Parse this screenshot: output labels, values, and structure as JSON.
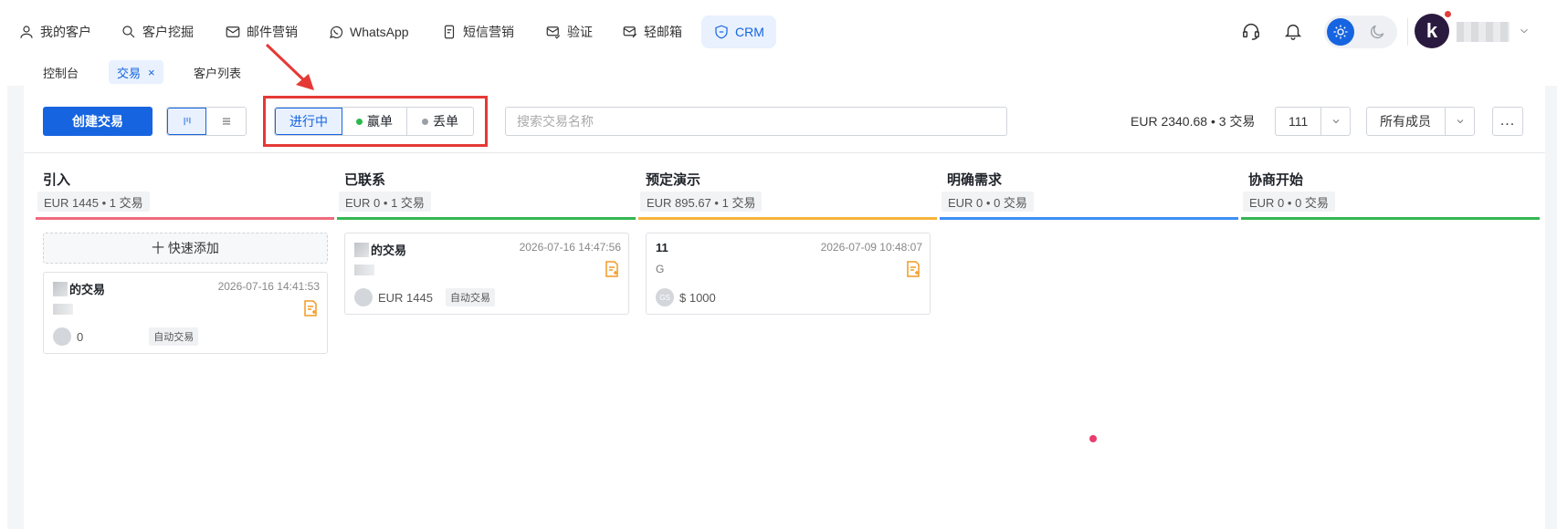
{
  "nav": {
    "items": [
      {
        "label": "我的客户",
        "icon": "user-icon"
      },
      {
        "label": "客户挖掘",
        "icon": "search-icon"
      },
      {
        "label": "邮件营销",
        "icon": "mail-icon"
      },
      {
        "label": "WhatsApp",
        "icon": "whatsapp-icon"
      },
      {
        "label": "短信营销",
        "icon": "sms-icon"
      },
      {
        "label": "验证",
        "icon": "mail-check-icon"
      },
      {
        "label": "轻邮箱",
        "icon": "mail-edit-icon"
      },
      {
        "label": "CRM",
        "icon": "shield-icon"
      }
    ],
    "active": "CRM"
  },
  "header_icons": [
    "headset-icon",
    "bell-icon",
    "sun-icon",
    "moon-icon",
    "avatar",
    "chevron-down-icon"
  ],
  "avatar_letter": "k",
  "subtabs": {
    "items": [
      {
        "label": "控制台"
      },
      {
        "label": "交易",
        "closable": true,
        "close": "×"
      },
      {
        "label": "客户列表"
      }
    ],
    "active": "交易"
  },
  "toolbar": {
    "create_label": "创建交易",
    "status": {
      "ongoing": "进行中",
      "won": "赢单",
      "lost": "丢单"
    },
    "search_placeholder": "搜索交易名称",
    "summary": "EUR 2340.68 • 3 交易",
    "pipeline_select": "111",
    "member_select": "所有成员",
    "more": "..."
  },
  "columns": [
    {
      "title": "引入",
      "stat": "EUR 1445  • 1 交易",
      "color": "#f06a7e"
    },
    {
      "title": "已联系",
      "stat": "EUR 0  • 1 交易",
      "color": "#35b653"
    },
    {
      "title": "预定演示",
      "stat": "EUR 895.67  • 1 交易",
      "color": "#f5b43c"
    },
    {
      "title": "明确需求",
      "stat": "EUR 0  • 0 交易",
      "color": "#3d8ff5"
    },
    {
      "title": "协商开始",
      "stat": "EUR 0  • 0 交易",
      "color": "#35b653"
    }
  ],
  "quick_add": "十 快速添加",
  "cards": [
    {
      "name": "的交易",
      "time": "2026-07-16 14:41:53",
      "amount": "0",
      "tag": "自动交易"
    },
    {
      "name": "的交易",
      "time": "2026-07-16 14:47:56",
      "amount": "EUR 1445",
      "tag": "自动交易"
    },
    {
      "name": "11",
      "time": "2026-07-09 10:48:07",
      "sub": "G",
      "avatar": "GS",
      "amount": "$ 1000"
    }
  ],
  "colors": {
    "primary": "#1664e0",
    "won_dot": "#2db84d",
    "lost_dot": "#9aa0a6",
    "annotation": "#e53935"
  }
}
